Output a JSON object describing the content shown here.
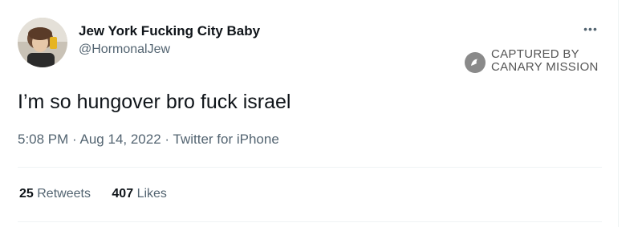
{
  "user": {
    "display_name": "Jew York Fucking City Baby",
    "handle": "@HormonalJew"
  },
  "more_icon": "more-horizontal-icon",
  "watermark": {
    "line1": "CAPTURED BY",
    "line2": "CANARY MISSION",
    "icon": "canary-bird-icon"
  },
  "tweet": {
    "text": "I’m so hungover bro fuck israel",
    "time": "5:08 PM",
    "date": "Aug 14, 2022",
    "source": "Twitter for iPhone",
    "dot": "·"
  },
  "stats": {
    "retweets_count": "25",
    "retweets_label": "Retweets",
    "likes_count": "407",
    "likes_label": "Likes"
  },
  "colors": {
    "text": "#0f1419",
    "secondary": "#536471",
    "divider": "#eff3f4",
    "watermark": "#555555"
  }
}
